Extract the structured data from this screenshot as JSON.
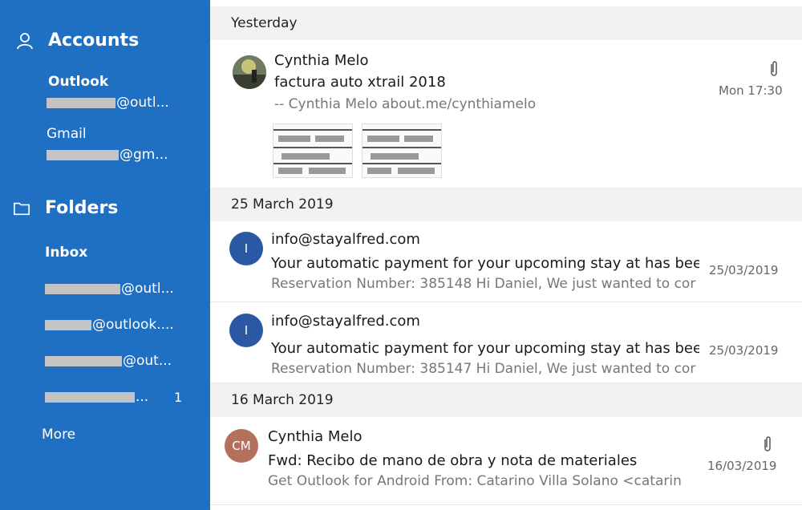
{
  "sidebar": {
    "accounts_title": "Accounts",
    "accounts": [
      {
        "name": "Outlook",
        "email_suffix": "@outl..."
      },
      {
        "name": "Gmail",
        "email_suffix": "@gm..."
      }
    ],
    "folders_title": "Folders",
    "folders": [
      {
        "label": "Inbox"
      },
      {
        "suffix": "@outl..."
      },
      {
        "suffix": "@outlook...."
      },
      {
        "suffix": "@out..."
      },
      {
        "suffix": "...",
        "count": "1"
      }
    ],
    "more_label": "More"
  },
  "groups": [
    {
      "date": "Yesterday",
      "messages": [
        {
          "sender": "Cynthia Melo",
          "subject": "factura auto xtrail 2018",
          "preview": "-- Cynthia Melo about.me/cynthiamelo",
          "date": "Mon 17:30",
          "attachment": true
        }
      ]
    },
    {
      "date": "25 March 2019",
      "messages": [
        {
          "initial": "I",
          "sender": "info@stayalfred.com",
          "subject": "Your automatic payment for your upcoming stay at  has been",
          "preview": "Reservation Number: 385148 Hi Daniel, We just wanted to cor",
          "date": "25/03/2019"
        },
        {
          "initial": "I",
          "sender": "info@stayalfred.com",
          "subject": "Your automatic payment for your upcoming stay at  has been",
          "preview": "Reservation Number: 385147 Hi Daniel, We just wanted to cor",
          "date": "25/03/2019"
        }
      ]
    },
    {
      "date": "16 March 2019",
      "messages": [
        {
          "initial": "CM",
          "sender": "Cynthia Melo",
          "subject": "Fwd: Recibo de mano de obra y nota de materiales",
          "preview": "Get Outlook for Android From: Catarino Villa Solano <catarin",
          "date": "16/03/2019",
          "attachment": true
        }
      ]
    }
  ],
  "colors": {
    "sidebar": "#1f6fc2",
    "avatar_blue": "#2a58a3",
    "avatar_brown": "#b5705c"
  },
  "icons": {
    "accounts": "person-icon",
    "folders": "folder-icon",
    "attachment": "paperclip-icon"
  }
}
